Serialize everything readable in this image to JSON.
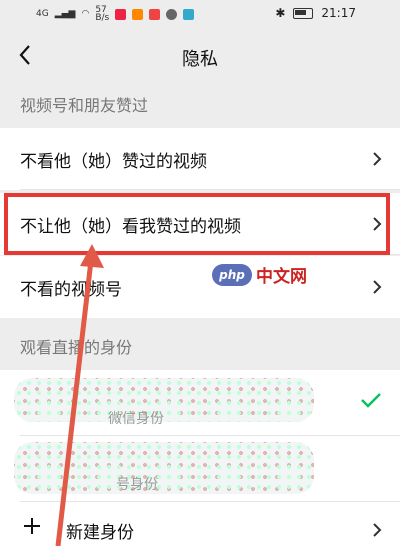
{
  "status_bar": {
    "time": "21:17",
    "signal_text": "4G",
    "speed_top": "57",
    "speed_unit": "B/s"
  },
  "header": {
    "title": "隐私"
  },
  "sections": [
    {
      "header": "视频号和朋友赞过",
      "items": [
        {
          "label": "不看他（她）赞过的视频"
        },
        {
          "label": "不让他（她）看我赞过的视频"
        },
        {
          "label": "不看的视频号"
        }
      ]
    },
    {
      "header": "观看直播的身份",
      "items": [
        {
          "sub": "微信身份",
          "selected": true
        },
        {
          "sub": "号身份"
        },
        {
          "label": "新建身份"
        }
      ]
    }
  ],
  "watermark": {
    "logo": "php",
    "text": "中文网"
  },
  "colors": {
    "highlight": "#e53935",
    "check": "#07c160"
  }
}
